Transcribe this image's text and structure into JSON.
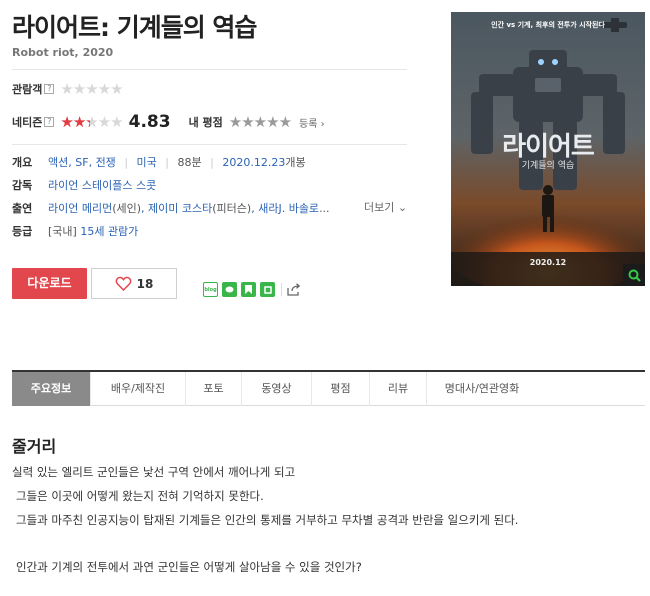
{
  "movie": {
    "title": "라이어트: 기계들의 역습",
    "original_title": "Robot riot, 2020"
  },
  "ratings": {
    "audience_label": "관람객",
    "netizen_label": "네티즌",
    "netizen_score": "4.83",
    "netizen_stars_fraction": 0.48,
    "my_rating_label": "내 평점",
    "register_label": "등록",
    "help_mark": "?"
  },
  "info": {
    "overview_label": "개요",
    "genres": [
      "액션",
      "SF",
      "전쟁"
    ],
    "country": "미국",
    "runtime": "88분",
    "release_date": "2020.12.23",
    "release_suffix": "개봉",
    "director_label": "감독",
    "director": "라이언 스테이플스 스콧",
    "cast_label": "출연",
    "cast": [
      {
        "name": "라이언 메리먼",
        "role": "(세인)"
      },
      {
        "name": "제이미 코스타",
        "role": "(피터슨)"
      },
      {
        "name": "새라J. 바솔로",
        "role": "..."
      }
    ],
    "more_label": "더보기",
    "grade_label": "등급",
    "grade_prefix": "[국내]",
    "grade": "15세 관람가"
  },
  "actions": {
    "download_label": "다운로드",
    "like_count": "18"
  },
  "poster": {
    "tagline": "인간 vs 기계, 최후의 전투가 시작된다",
    "title": "라이어트",
    "subtitle": "기계들의 역습",
    "date": "2020.12"
  },
  "tabs": [
    "주요정보",
    "배우/제작진",
    "포토",
    "동영상",
    "평점",
    "리뷰",
    "명대사/연관영화"
  ],
  "synopsis": {
    "heading": "줄거리",
    "lines": [
      "실력 있는 엘리트 군인들은 낯선 구역 안에서 깨어나게 되고",
      "그들은 이곳에 어떻게 왔는지 전혀 기억하지 못한다.",
      "그들과 마주친 인공지능이 탑재된 기계들은 인간의 통제를 거부하고 무차별 공격과 반란을 일으키게 된다.",
      "인간과 기계의 전투에서 과연 군인들은 어떻게 살아남을 수 있을 것인가?"
    ]
  },
  "colors": {
    "accent_red": "#e2474d",
    "link_blue": "#2b63b5",
    "tab_active": "#8a8a8a"
  }
}
